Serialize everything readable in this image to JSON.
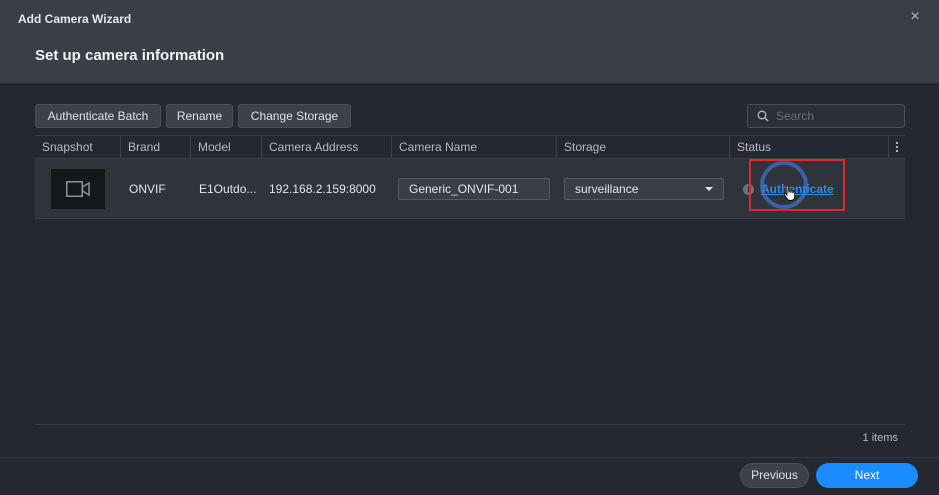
{
  "window": {
    "title": "Add Camera Wizard",
    "subtitle": "Set up camera information"
  },
  "toolbar": {
    "authenticate_batch": "Authenticate Batch",
    "rename": "Rename",
    "change_storage": "Change Storage",
    "search_placeholder": "Search"
  },
  "table": {
    "columns": [
      "Snapshot",
      "Brand",
      "Model",
      "Camera Address",
      "Camera Name",
      "Storage",
      "Status"
    ],
    "rows": [
      {
        "brand": "ONVIF",
        "model": "E1Outdo...",
        "address": "192.168.2.159:8000",
        "camera_name": "Generic_ONVIF-001",
        "storage": "surveillance",
        "status_link": "Authenticate"
      }
    ],
    "item_count": "1 items"
  },
  "footer": {
    "previous": "Previous",
    "next": "Next"
  },
  "colors": {
    "accent": "#1a8cff",
    "link": "#2f8ae6",
    "highlight": "#e3262b"
  },
  "icons": [
    "close-icon",
    "search-icon",
    "camera-icon",
    "info-icon",
    "hand-cursor-icon",
    "column-menu-icon"
  ]
}
